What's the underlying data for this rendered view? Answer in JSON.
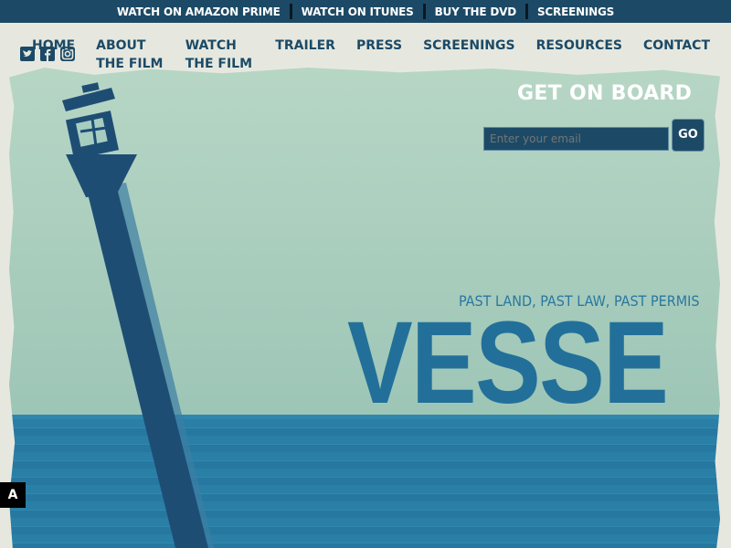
{
  "topbar": {
    "links": [
      "WATCH ON AMAZON PRIME",
      "WATCH ON ITUNES",
      "BUY THE DVD",
      "SCREENINGS"
    ]
  },
  "nav": {
    "items": [
      "HOME",
      "ABOUT THE FILM",
      "WATCH THE FILM",
      "TRAILER",
      "PRESS",
      "SCREENINGS",
      "RESOURCES",
      "CONTACT"
    ]
  },
  "social": [
    "twitter-icon",
    "facebook-icon",
    "instagram-icon"
  ],
  "hero": {
    "tagline": "PAST LAND, PAST LAW, PAST PERMIS",
    "title": "VESSE"
  },
  "signup": {
    "title": "GET ON BOARD",
    "email_placeholder": "Enter your email",
    "go_label": "GO"
  },
  "accessibility_button": "A",
  "colors": {
    "navy": "#1c4a66",
    "sea": "#2a7fa7",
    "title_blue": "#22709a",
    "paper": "#e6e8df"
  }
}
